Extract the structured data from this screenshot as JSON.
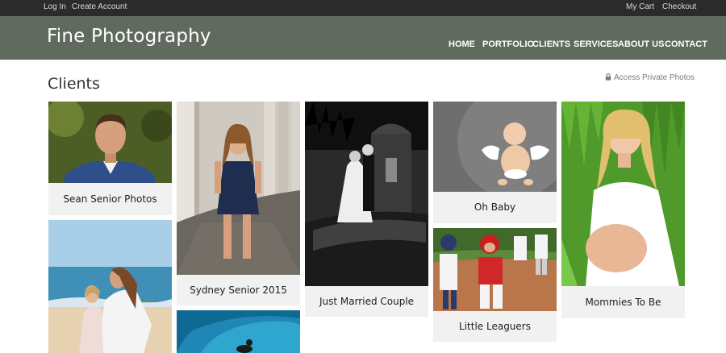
{
  "topbar": {
    "login": "Log In",
    "create_account": "Create Account",
    "my_cart": "My Cart",
    "checkout": "Checkout"
  },
  "header": {
    "brand": "Fine Photography"
  },
  "nav": [
    "HOME",
    "PORTFOLIO",
    "CLIENTS",
    "SERVICES",
    "ABOUT US",
    "CONTACT"
  ],
  "page": {
    "title": "Clients",
    "private_link": "Access Private Photos"
  },
  "galleries": [
    {
      "caption": "Sean Senior Photos"
    },
    {
      "caption": "Sydney Senior 2015"
    },
    {
      "caption": "Just Married Couple"
    },
    {
      "caption": "Oh Baby"
    },
    {
      "caption": "Mommies To Be"
    },
    {
      "caption": "Little Leaguers"
    },
    {
      "caption": ""
    },
    {
      "caption": ""
    }
  ],
  "colors": {
    "topbar_bg": "#2b2b2b",
    "header_bg": "#616a5f",
    "caption_bg": "#f1f1f1"
  },
  "icons": {
    "private_link": "lock-icon"
  }
}
